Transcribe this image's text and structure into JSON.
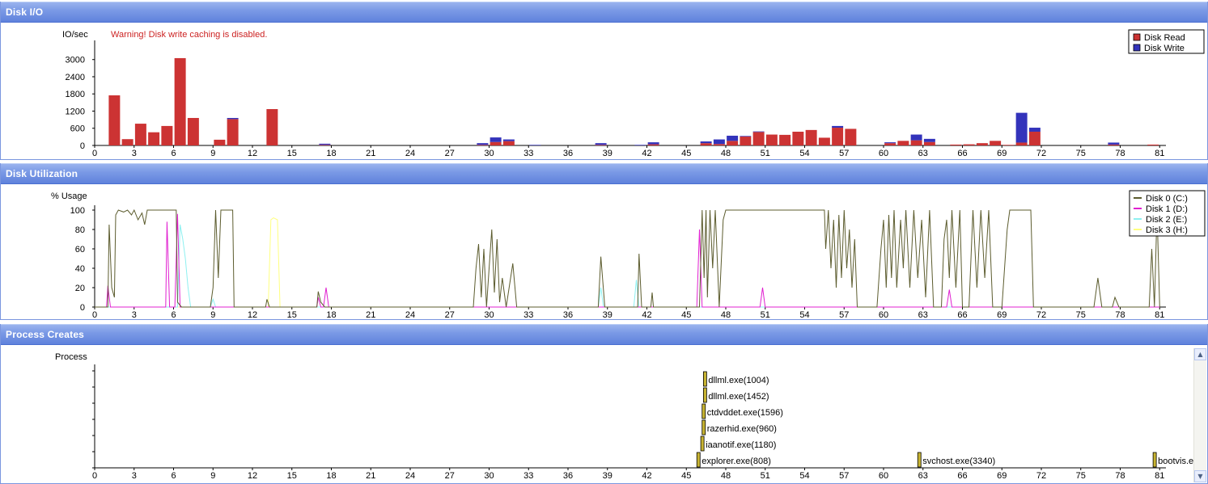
{
  "panels": {
    "diskio": {
      "title": "Disk I/O"
    },
    "diskutil": {
      "title": "Disk Utilization"
    },
    "process": {
      "title": "Process Creates"
    }
  },
  "colors": {
    "read": "#cc3333",
    "write": "#3333bb",
    "disk0": "#5c5c2e",
    "disk1": "#e020d0",
    "disk2": "#8ef0f0",
    "disk3": "#ffff80",
    "process_bar": "#c8b432",
    "warning": "#cc2222"
  },
  "chart_data": [
    {
      "type": "bar",
      "stacked": true,
      "ylabel": "IO/sec",
      "warning": "Warning!  Disk write caching is disabled.",
      "ylim": [
        0,
        3500
      ],
      "yticks": [
        0,
        600,
        1200,
        1800,
        2400,
        3000
      ],
      "xlim": [
        0,
        84
      ],
      "xticks": [
        0,
        3,
        6,
        9,
        12,
        15,
        18,
        21,
        24,
        27,
        30,
        33,
        36,
        39,
        42,
        45,
        48,
        51,
        54,
        57,
        60,
        63,
        66,
        69,
        72,
        75,
        78,
        81
      ],
      "legend": "top-right",
      "series": [
        {
          "name": "Disk Read",
          "color": "#cc3333"
        },
        {
          "name": "Disk Write",
          "color": "#3333bb"
        }
      ],
      "x": [
        1.5,
        2.5,
        3.5,
        4.5,
        5.5,
        6.5,
        7.5,
        9.5,
        10.5,
        13.5,
        17.5,
        29.5,
        30.5,
        31.5,
        33.5,
        38.5,
        41.5,
        42.5,
        46.5,
        47.5,
        48.5,
        49.5,
        50.5,
        51.5,
        52.5,
        53.5,
        54.5,
        55.5,
        56.5,
        57.5,
        60.5,
        61.5,
        62.5,
        63.5,
        65.5,
        66.5,
        67.5,
        68.5,
        69.5,
        70.5,
        71.5,
        77.5,
        80.5
      ],
      "read": [
        1750,
        220,
        760,
        460,
        680,
        3050,
        960,
        200,
        920,
        1270,
        20,
        20,
        120,
        150,
        0,
        20,
        0,
        40,
        80,
        50,
        160,
        310,
        470,
        380,
        370,
        480,
        540,
        270,
        620,
        580,
        80,
        160,
        180,
        120,
        30,
        40,
        80,
        160,
        20,
        100,
        480,
        30,
        30
      ],
      "write": [
        0,
        0,
        0,
        0,
        0,
        0,
        0,
        0,
        40,
        0,
        40,
        60,
        160,
        60,
        20,
        60,
        20,
        70,
        60,
        160,
        180,
        20,
        20,
        0,
        0,
        0,
        0,
        0,
        60,
        0,
        30,
        0,
        200,
        110,
        0,
        0,
        0,
        0,
        0,
        1040,
        140,
        70,
        0
      ]
    },
    {
      "type": "line",
      "ylabel": "% Usage",
      "ylim": [
        0,
        110
      ],
      "yticks": [
        0,
        20,
        40,
        60,
        80,
        100
      ],
      "xlim": [
        0,
        84
      ],
      "xticks": [
        0,
        3,
        6,
        9,
        12,
        15,
        18,
        21,
        24,
        27,
        30,
        33,
        36,
        39,
        42,
        45,
        48,
        51,
        54,
        57,
        60,
        63,
        66,
        69,
        72,
        75,
        78,
        81
      ],
      "legend": "top-right",
      "series": [
        {
          "name": "Disk 0 (C:)",
          "color": "#5c5c2e",
          "points": [
            [
              0,
              0
            ],
            [
              1,
              0
            ],
            [
              1.1,
              85
            ],
            [
              1.3,
              20
            ],
            [
              1.5,
              10
            ],
            [
              1.6,
              95
            ],
            [
              1.8,
              100
            ],
            [
              2.2,
              98
            ],
            [
              2.5,
              100
            ],
            [
              2.8,
              95
            ],
            [
              3,
              100
            ],
            [
              3.3,
              90
            ],
            [
              3.6,
              97
            ],
            [
              3.8,
              85
            ],
            [
              4,
              100
            ],
            [
              4.5,
              100
            ],
            [
              5,
              100
            ],
            [
              5.5,
              100
            ],
            [
              6,
              100
            ],
            [
              6.2,
              100
            ],
            [
              6.3,
              5
            ],
            [
              6.6,
              0
            ],
            [
              8,
              0
            ],
            [
              8.8,
              0
            ],
            [
              9,
              20
            ],
            [
              9.2,
              100
            ],
            [
              9.4,
              30
            ],
            [
              9.6,
              100
            ],
            [
              10,
              100
            ],
            [
              10.5,
              100
            ],
            [
              10.6,
              0
            ],
            [
              13,
              0
            ],
            [
              13.1,
              8
            ],
            [
              13.3,
              0
            ],
            [
              16.9,
              0
            ],
            [
              17,
              16
            ],
            [
              17.2,
              5
            ],
            [
              17.5,
              0
            ],
            [
              28.8,
              0
            ],
            [
              29,
              40
            ],
            [
              29.2,
              65
            ],
            [
              29.4,
              10
            ],
            [
              29.6,
              60
            ],
            [
              29.8,
              0
            ],
            [
              30,
              40
            ],
            [
              30.2,
              80
            ],
            [
              30.4,
              15
            ],
            [
              30.6,
              70
            ],
            [
              30.8,
              5
            ],
            [
              31,
              30
            ],
            [
              31.3,
              0
            ],
            [
              31.8,
              45
            ],
            [
              32.1,
              0
            ],
            [
              38.3,
              0
            ],
            [
              38.5,
              52
            ],
            [
              38.8,
              0
            ],
            [
              41.3,
              0
            ],
            [
              41.4,
              55
            ],
            [
              41.6,
              0
            ],
            [
              42.3,
              0
            ],
            [
              42.4,
              15
            ],
            [
              42.5,
              0
            ],
            [
              46,
              0
            ],
            [
              46.2,
              100
            ],
            [
              46.35,
              30
            ],
            [
              46.5,
              100
            ],
            [
              46.6,
              10
            ],
            [
              46.8,
              100
            ],
            [
              47,
              40
            ],
            [
              47.2,
              100
            ],
            [
              47.5,
              0
            ],
            [
              47.8,
              90
            ],
            [
              48,
              100
            ],
            [
              48.5,
              100
            ],
            [
              49,
              100
            ],
            [
              50,
              100
            ],
            [
              52,
              100
            ],
            [
              54,
              100
            ],
            [
              55.5,
              100
            ],
            [
              55.6,
              60
            ],
            [
              55.8,
              100
            ],
            [
              56,
              40
            ],
            [
              56.2,
              90
            ],
            [
              56.4,
              20
            ],
            [
              56.6,
              95
            ],
            [
              56.8,
              30
            ],
            [
              57,
              100
            ],
            [
              57.2,
              40
            ],
            [
              57.4,
              80
            ],
            [
              57.6,
              20
            ],
            [
              57.8,
              70
            ],
            [
              58,
              0
            ],
            [
              59,
              0
            ],
            [
              59.5,
              0
            ],
            [
              59.8,
              60
            ],
            [
              60,
              90
            ],
            [
              60.2,
              20
            ],
            [
              60.4,
              95
            ],
            [
              60.6,
              30
            ],
            [
              60.8,
              100
            ],
            [
              61,
              20
            ],
            [
              61.3,
              90
            ],
            [
              61.5,
              40
            ],
            [
              61.7,
              100
            ],
            [
              62,
              20
            ],
            [
              62.3,
              100
            ],
            [
              62.6,
              30
            ],
            [
              62.9,
              90
            ],
            [
              63.2,
              10
            ],
            [
              63.5,
              100
            ],
            [
              63.8,
              0
            ],
            [
              64.4,
              0
            ],
            [
              64.6,
              70
            ],
            [
              64.8,
              90
            ],
            [
              65,
              30
            ],
            [
              65.2,
              100
            ],
            [
              65.5,
              20
            ],
            [
              65.8,
              100
            ],
            [
              66,
              0
            ],
            [
              66.5,
              0
            ],
            [
              66.8,
              100
            ],
            [
              67.1,
              20
            ],
            [
              67.4,
              100
            ],
            [
              67.7,
              30
            ],
            [
              68,
              100
            ],
            [
              68.3,
              0
            ],
            [
              69,
              0
            ],
            [
              69.4,
              80
            ],
            [
              69.6,
              100
            ],
            [
              70,
              100
            ],
            [
              70.4,
              100
            ],
            [
              70.8,
              100
            ],
            [
              71.2,
              100
            ],
            [
              71.4,
              0
            ],
            [
              72,
              0
            ],
            [
              76,
              0
            ],
            [
              76.3,
              30
            ],
            [
              76.6,
              0
            ],
            [
              77.4,
              0
            ],
            [
              77.6,
              10
            ],
            [
              77.9,
              0
            ],
            [
              80.2,
              0
            ],
            [
              80.4,
              60
            ],
            [
              80.6,
              0
            ],
            [
              80.8,
              100
            ],
            [
              81,
              0
            ]
          ]
        },
        {
          "name": "Disk 1 (D:)",
          "color": "#e020d0",
          "points": [
            [
              0,
              0
            ],
            [
              0.9,
              0
            ],
            [
              1,
              22
            ],
            [
              1.2,
              0
            ],
            [
              5.4,
              0
            ],
            [
              5.5,
              88
            ],
            [
              5.7,
              0
            ],
            [
              6.1,
              0
            ],
            [
              6.3,
              96
            ],
            [
              6.5,
              0
            ],
            [
              16.9,
              0
            ],
            [
              17,
              10
            ],
            [
              17.2,
              0
            ],
            [
              17.4,
              0
            ],
            [
              17.6,
              20
            ],
            [
              17.8,
              0
            ],
            [
              45.8,
              0
            ],
            [
              46,
              80
            ],
            [
              46.2,
              0
            ],
            [
              50.6,
              0
            ],
            [
              50.8,
              20
            ],
            [
              51,
              0
            ],
            [
              64.8,
              0
            ],
            [
              65,
              18
            ],
            [
              65.2,
              0
            ],
            [
              81,
              0
            ]
          ]
        },
        {
          "name": "Disk 2 (E:)",
          "color": "#8ef0f0",
          "points": [
            [
              0,
              0
            ],
            [
              6.3,
              0
            ],
            [
              6.5,
              85
            ],
            [
              6.7,
              70
            ],
            [
              6.9,
              50
            ],
            [
              7.1,
              20
            ],
            [
              7.3,
              0
            ],
            [
              8.8,
              0
            ],
            [
              9,
              8
            ],
            [
              9.2,
              0
            ],
            [
              38.3,
              0
            ],
            [
              38.5,
              20
            ],
            [
              38.7,
              0
            ],
            [
              41,
              0
            ],
            [
              41.2,
              28
            ],
            [
              41.4,
              0
            ],
            [
              81,
              0
            ]
          ]
        },
        {
          "name": "Disk 3 (H:)",
          "color": "#ffff80",
          "points": [
            [
              0,
              0
            ],
            [
              13.2,
              0
            ],
            [
              13.4,
              90
            ],
            [
              13.6,
              92
            ],
            [
              13.9,
              90
            ],
            [
              14.1,
              0
            ],
            [
              81,
              0
            ]
          ]
        }
      ]
    },
    {
      "type": "timeline",
      "ylabel": "Process",
      "xlim": [
        0,
        84
      ],
      "xticks": [
        0,
        3,
        6,
        9,
        12,
        15,
        18,
        21,
        24,
        27,
        30,
        33,
        36,
        39,
        42,
        45,
        48,
        51,
        54,
        57,
        60,
        63,
        66,
        69,
        72,
        75,
        78,
        81
      ],
      "events": [
        {
          "label": "dllml.exe(1004)",
          "x": 46.3,
          "row": 5
        },
        {
          "label": "dllml.exe(1452)",
          "x": 46.3,
          "row": 4
        },
        {
          "label": "ctdvddet.exe(1596)",
          "x": 46.2,
          "row": 3
        },
        {
          "label": "razerhid.exe(960)",
          "x": 46.2,
          "row": 2
        },
        {
          "label": "iaanotif.exe(1180)",
          "x": 46.1,
          "row": 1
        },
        {
          "label": "explorer.exe(808)",
          "x": 45.8,
          "row": 0
        },
        {
          "label": "svchost.exe(3340)",
          "x": 62.6,
          "row": 0
        },
        {
          "label": "bootvis.exe",
          "x": 80.5,
          "row": 0
        }
      ]
    }
  ]
}
